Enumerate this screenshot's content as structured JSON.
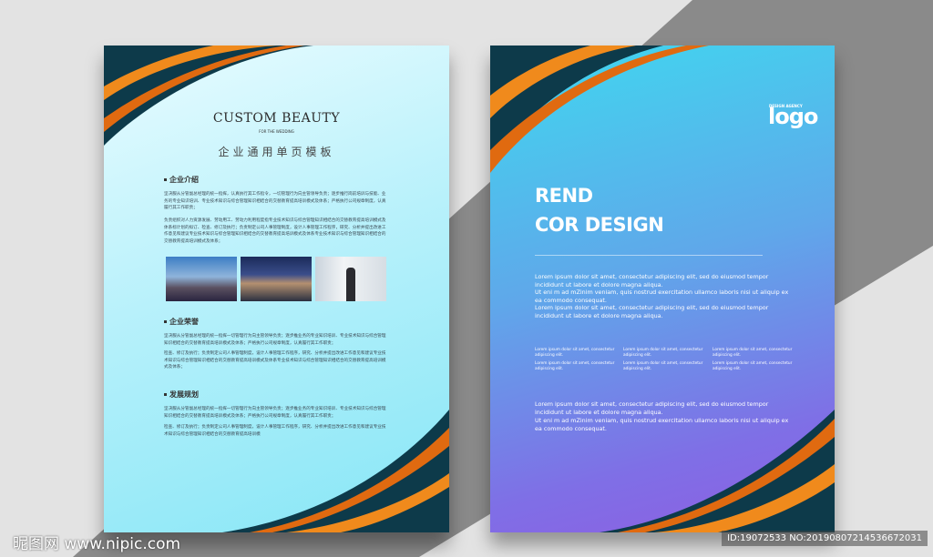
{
  "left_page": {
    "title": "CUSTOM BEAUTY",
    "subtitle": "FOR THE WEDDING",
    "cn_title": "企业通用单页模板",
    "sections": [
      {
        "heading": "企业介绍",
        "paragraphs": [
          "坚决服从分管副总经理的统一指挥，认真执行其工作指令，一切管理行为向主管领导负责；逐步推行岗前培训与技能、业务的专业知识培训、专业技术知识与综合管理知识相结合的交替教育提高培训模式及体系；严格执行公司规章制度，认真履行其工作职责；",
          "负责组织对人力资源发展、劳动用工、劳动力利用程度指专业技术知识与综合管理知识相结合的交替教育提高培训模式及体系标计划的拟订、检查、修订及执行；负责制定公司人事管理制度，设计人事管理工作程序，研究、分析并提出改进工作意见和建议专业技术知识与综合管理知识相结合的交替教育提高培训模式及体系专业技术知识与综合管理知识相结合的交替教育提高培训模式及体系；"
        ]
      },
      {
        "heading": "企业荣誉",
        "paragraphs": [
          "坚决服从分管副总经理的统一指挥一切管理行为向主管领导负责；逐步推业务的专业知识培训、专业技术知识与综合管理知识相结合的交替教育提高培训模式及体系；严格执行公司规章制度，认真履行其工作职责；",
          "检查、修订及执行；负责制定公司人事管理制度，设计人事管理工作程序，研究、分析并提出改进工作意见和建议专业技术知识与综合管理知识相结合的交替教育提高培训模式及体系专业技术知识与综合管理知识相结合的交替教育提高培训模式及体系；"
        ]
      },
      {
        "heading": "发展规划",
        "paragraphs": [
          "坚决服从分管副总经理的统一指挥一切管理行为向主管领导负责；逐步推业务的专业知识培训、专业技术知识与综合管理知识相结合的交替教育提高培训模式及体系；严格执行公司规章制度，认真履行其工作职责；",
          "检查、修订及执行；负责制定公司人事管理制度，设计人事管理工作程序，研究、分析并提出改进工作意见和建议专业技术知识与综合管理知识相结合的交替教育提高培训模"
        ]
      }
    ],
    "photos": [
      "city-skyline-photo",
      "villa-pool-photo",
      "businessman-city-photo"
    ]
  },
  "right_page": {
    "logo_tagline": "DESIGN AGENCY",
    "logo": "logo",
    "hero_line1": "REND",
    "hero_line2": "COR DESIGN",
    "para1": "Lorem ipsum dolor sit amet, consectetur adipiscing elit, sed do eiusmod tempor incididunt ut labore et dolore magna aliqua.",
    "para2": "Ut eni m ad mZinim veniam, quis nostrud exercitation ullamco laboris nisi ut aliquip ex ea commodo consequat.",
    "para3": "Lorem ipsum dolor sit amet, consectetur adipiscing elit, sed do eiusmod tempor incididunt ut labore et dolore magna aliqua.",
    "small_items": [
      "Lorem ipsum dolor sit amet, consectetur adipiscing elit.",
      "Lorem ipsum dolor sit amet, consectetur adipiscing elit.",
      "Lorem ipsum dolor sit amet, consectetur adipiscing elit.",
      "Lorem ipsum dolor sit amet, consectetur adipiscing elit.",
      "Lorem ipsum dolor sit amet, consectetur adipiscing elit.",
      "Lorem ipsum dolor sit amet, consectetur adipiscing elit."
    ],
    "para4": "Lorem ipsum dolor sit amet, consectetur adipiscing elit, sed do eiusmod tempor incididunt ut labore et dolore magna aliqua.",
    "para5": "Ut eni m ad mZinim veniam, quis nostrud exercitation ullamco laboris nisi ut aliquip ex ea commodo consequat."
  },
  "watermark": {
    "site": "昵图网 www.nipic.com",
    "id": "ID:19072533 NO:20190807214536672031"
  },
  "colors": {
    "orange": "#f08a1c",
    "dark_teal": "#0d3a4a",
    "cyan": "#86e6f6",
    "purple": "#8e5ee2"
  }
}
